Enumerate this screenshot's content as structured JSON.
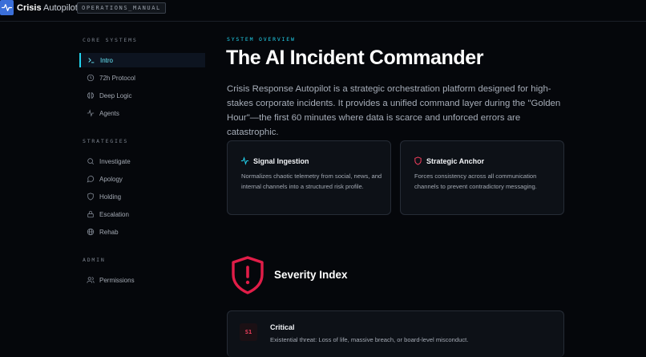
{
  "app": {
    "brand_bold": "Crisis",
    "brand_rest": "Autopilot",
    "badge": "OPERATIONS_MANUAL"
  },
  "sidebar": {
    "sections": [
      {
        "title": "CORE SYSTEMS"
      },
      {
        "title": "STRATEGIES"
      },
      {
        "title": "ADMIN"
      }
    ],
    "items": [
      {
        "label": "Intro",
        "icon": "terminal-icon",
        "active": true
      },
      {
        "label": "72h Protocol",
        "icon": "clock-icon"
      },
      {
        "label": "Deep Logic",
        "icon": "brain-icon"
      },
      {
        "label": "Agents",
        "icon": "activity-icon"
      },
      {
        "label": "Investigate",
        "icon": "search-icon"
      },
      {
        "label": "Apology",
        "icon": "message-circle-icon"
      },
      {
        "label": "Holding",
        "icon": "shield-icon"
      },
      {
        "label": "Escalation",
        "icon": "lock-icon"
      },
      {
        "label": "Rehab",
        "icon": "globe-icon"
      },
      {
        "label": "Permissions",
        "icon": "users-icon"
      }
    ]
  },
  "main": {
    "eyebrow": "SYSTEM OVERVIEW",
    "title": "The AI Incident Commander",
    "intro": "Crisis Response Autopilot is a strategic orchestration platform designed for high-stakes corporate incidents. It provides a unified command layer during the \"Golden Hour\"—the first 60 minutes where data is scarce and unforced errors are catastrophic.",
    "cards": [
      {
        "title": "Signal Ingestion",
        "icon": "activity-icon",
        "body": "Normalizes chaotic telemetry from social, news, and internal channels into a structured risk profile."
      },
      {
        "title": "Strategic Anchor",
        "icon": "shield-icon",
        "body": "Forces consistency across all communication channels to prevent contradictory messaging."
      }
    ],
    "severity": {
      "title": "Severity Index",
      "icon": "shield-alert-icon",
      "levels": [
        {
          "tag": "S1",
          "name": "Critical",
          "description": "Existential threat: Loss of life, massive breach, or board-level misconduct."
        }
      ]
    }
  },
  "colors": {
    "accent": "#22d3ee",
    "danger": "#e11d48",
    "background": "#05070b",
    "card": "#0d1117"
  }
}
